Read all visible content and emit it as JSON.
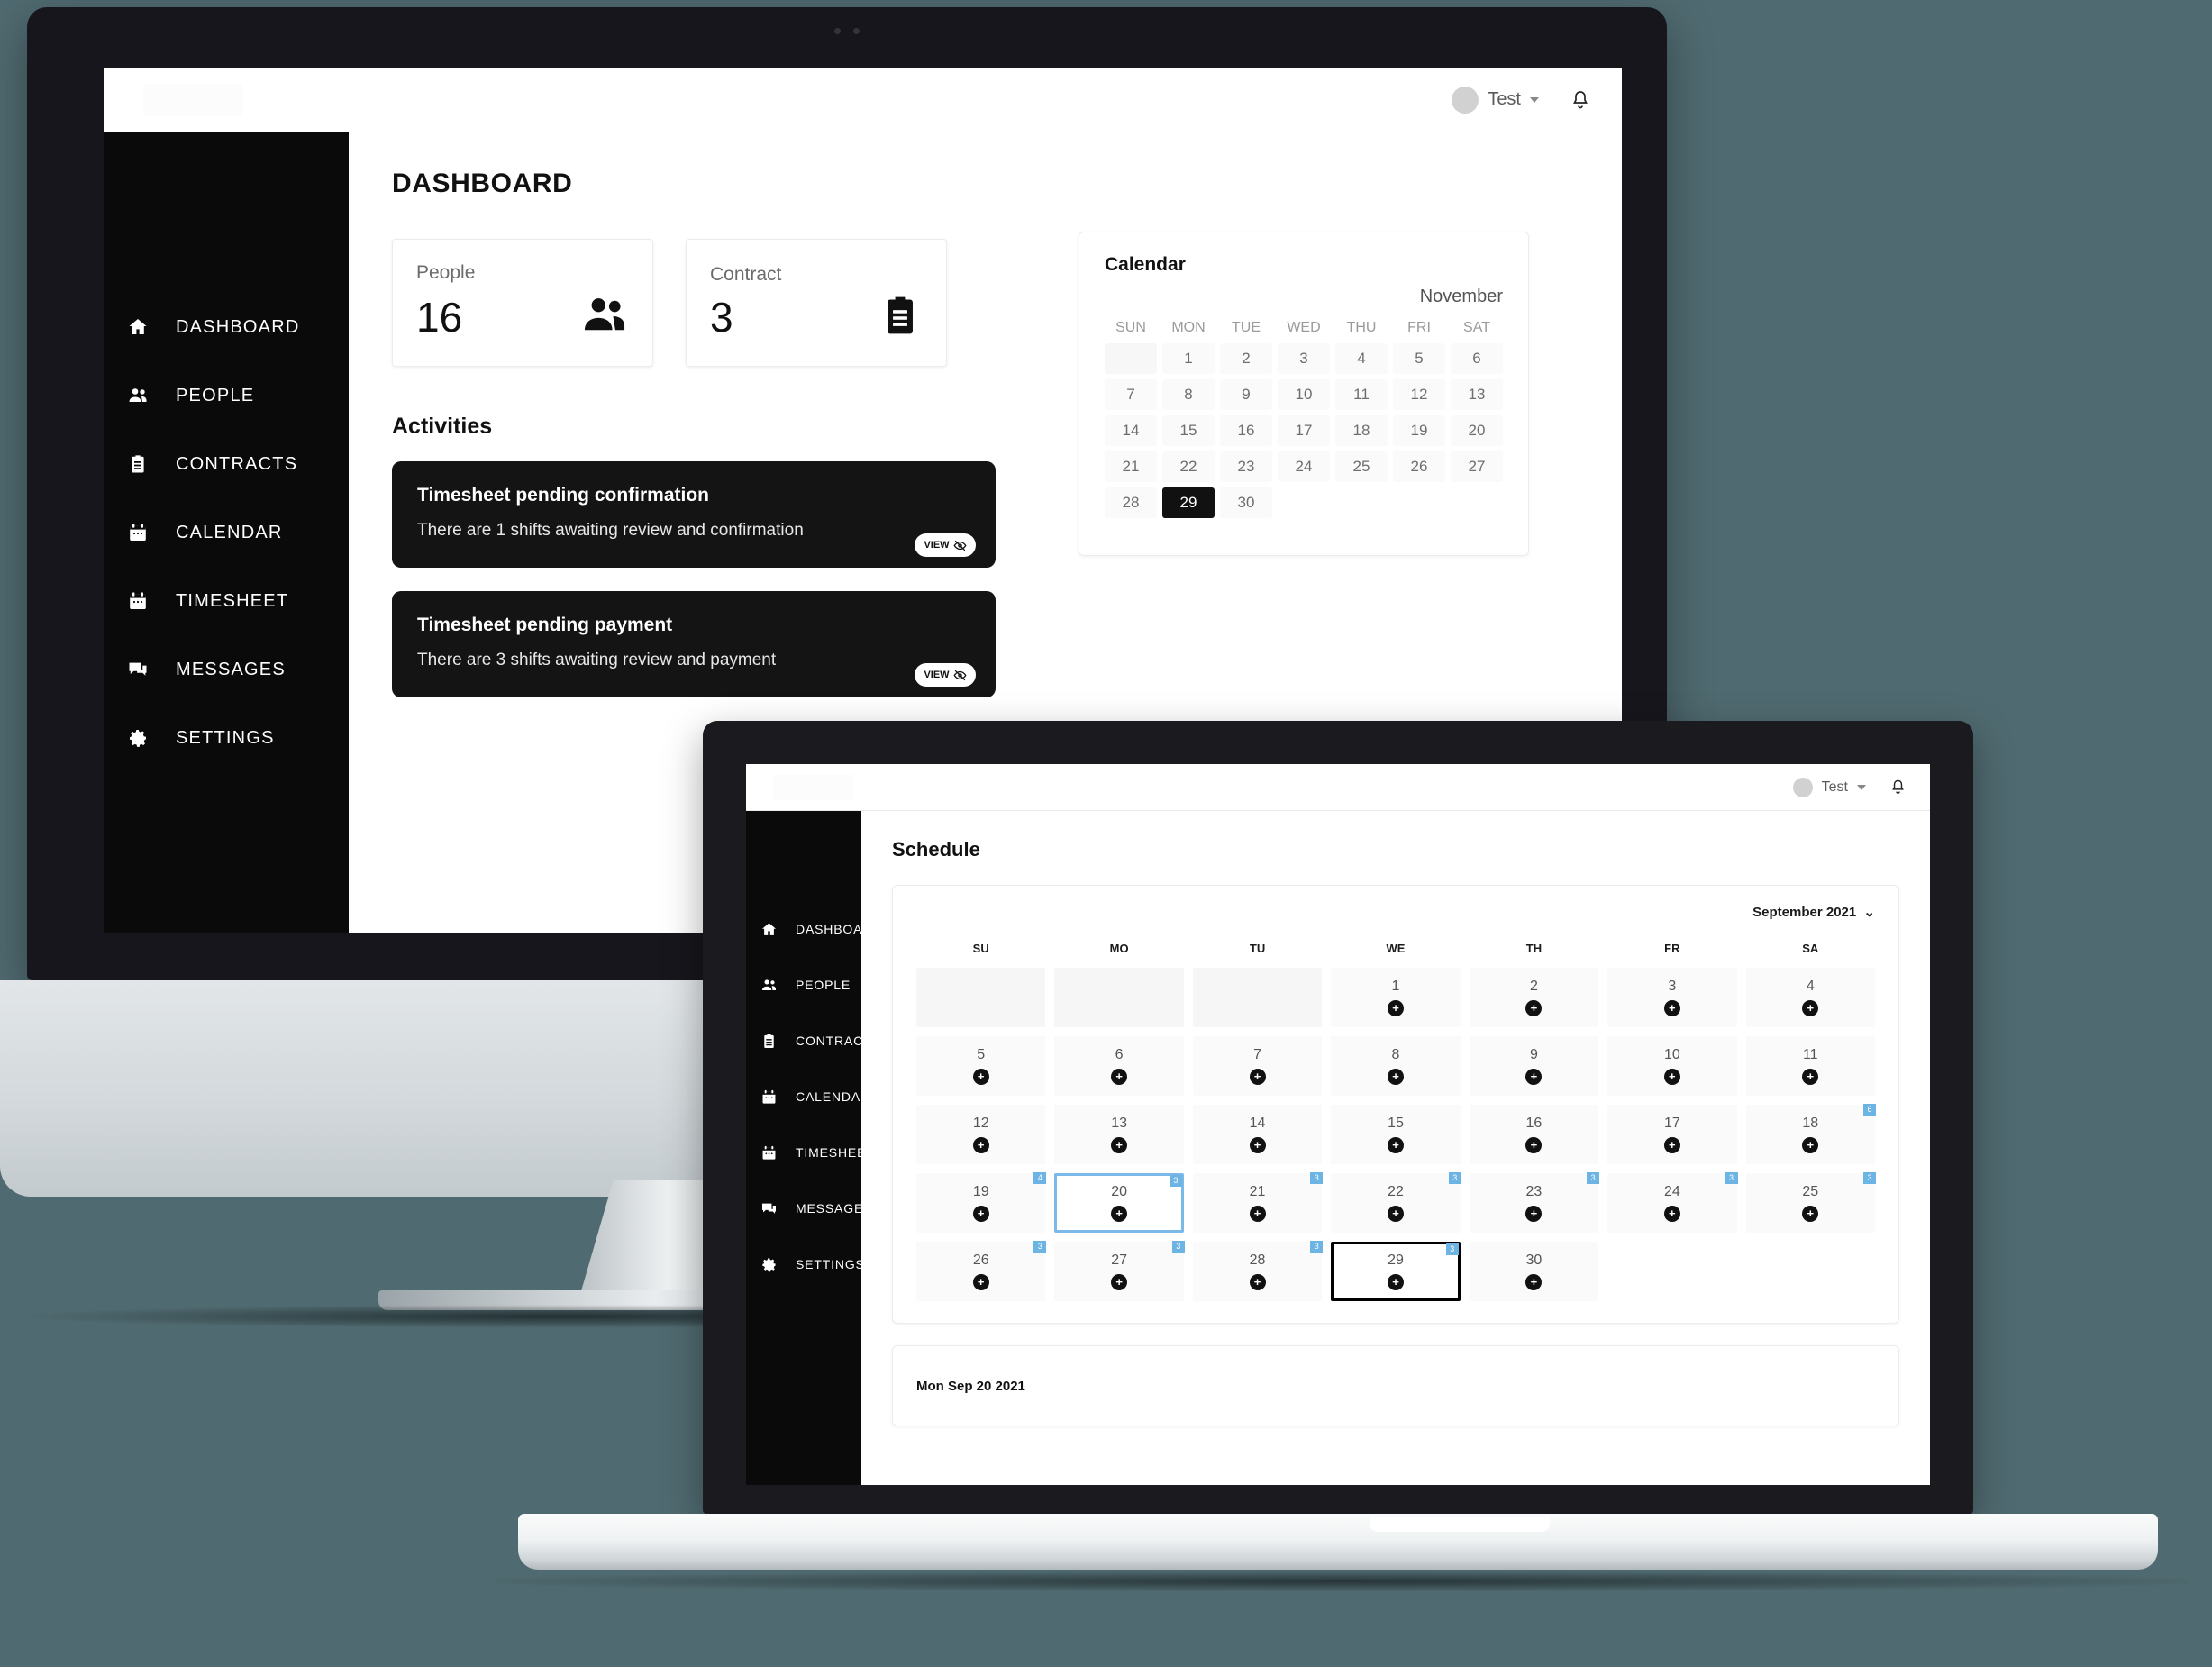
{
  "theme": {
    "accent": "#6cb4e4",
    "dark": "#0a0a0a",
    "card_dark": "#141414",
    "background": "#4f6a70"
  },
  "topbar": {
    "user_name": "Test",
    "avatar_icon": "avatar-circle",
    "caret_icon": "chevron-down-icon",
    "bell_icon": "bell-icon"
  },
  "sidebar": {
    "items": [
      {
        "label": "DASHBOARD",
        "icon": "home-icon"
      },
      {
        "label": "PEOPLE",
        "icon": "people-icon"
      },
      {
        "label": "CONTRACTS",
        "icon": "clipboard-icon"
      },
      {
        "label": "CALENDAR",
        "icon": "calendar-icon"
      },
      {
        "label": "TIMESHEET",
        "icon": "calendar-icon"
      },
      {
        "label": "MESSAGES",
        "icon": "chat-icon"
      },
      {
        "label": "SETTINGS",
        "icon": "gear-icon"
      }
    ]
  },
  "desktop": {
    "page_title": "DASHBOARD",
    "stats": [
      {
        "label": "People",
        "value": "16",
        "icon": "people-icon"
      },
      {
        "label": "Contract",
        "value": "3",
        "icon": "clipboard-icon"
      }
    ],
    "activities_heading": "Activities",
    "activities": [
      {
        "title": "Timesheet pending confirmation",
        "subtitle": "There are 1 shifts awaiting review and confirmation",
        "button_label": "VIEW",
        "button_icon": "eye-slash-icon"
      },
      {
        "title": "Timesheet pending payment",
        "subtitle": "There are 3 shifts awaiting review and payment",
        "button_label": "VIEW",
        "button_icon": "eye-slash-icon"
      }
    ],
    "calendar": {
      "title": "Calendar",
      "month": "November",
      "dow": [
        "SUN",
        "MON",
        "TUE",
        "WED",
        "THU",
        "FRI",
        "SAT"
      ],
      "lead_blanks": 1,
      "days": [
        1,
        2,
        3,
        4,
        5,
        6,
        7,
        8,
        9,
        10,
        11,
        12,
        13,
        14,
        15,
        16,
        17,
        18,
        19,
        20,
        21,
        22,
        23,
        24,
        25,
        26,
        27,
        28,
        29,
        30
      ],
      "today": 29
    }
  },
  "laptop": {
    "page_title": "Schedule",
    "schedule": {
      "month_label": "September 2021",
      "month_caret_icon": "chevron-down-icon",
      "dow": [
        "SU",
        "MO",
        "TU",
        "WE",
        "TH",
        "FR",
        "SA"
      ],
      "lead_blanks": 3,
      "add_icon": "plus-icon",
      "days": [
        {
          "n": 1
        },
        {
          "n": 2
        },
        {
          "n": 3
        },
        {
          "n": 4
        },
        {
          "n": 5
        },
        {
          "n": 6
        },
        {
          "n": 7
        },
        {
          "n": 8
        },
        {
          "n": 9
        },
        {
          "n": 10
        },
        {
          "n": 11
        },
        {
          "n": 12
        },
        {
          "n": 13
        },
        {
          "n": 14
        },
        {
          "n": 15
        },
        {
          "n": 16
        },
        {
          "n": 17
        },
        {
          "n": 18,
          "badge": "6"
        },
        {
          "n": 19,
          "badge": "4"
        },
        {
          "n": 20,
          "badge": "3",
          "selected": true
        },
        {
          "n": 21,
          "badge": "3"
        },
        {
          "n": 22,
          "badge": "3"
        },
        {
          "n": 23,
          "badge": "3"
        },
        {
          "n": 24,
          "badge": "3"
        },
        {
          "n": 25,
          "badge": "3"
        },
        {
          "n": 26,
          "badge": "3"
        },
        {
          "n": 27,
          "badge": "3"
        },
        {
          "n": 28,
          "badge": "3"
        },
        {
          "n": 29,
          "badge": "3",
          "today": true
        },
        {
          "n": 30
        }
      ],
      "selected_day_label": "Mon Sep 20 2021"
    }
  }
}
